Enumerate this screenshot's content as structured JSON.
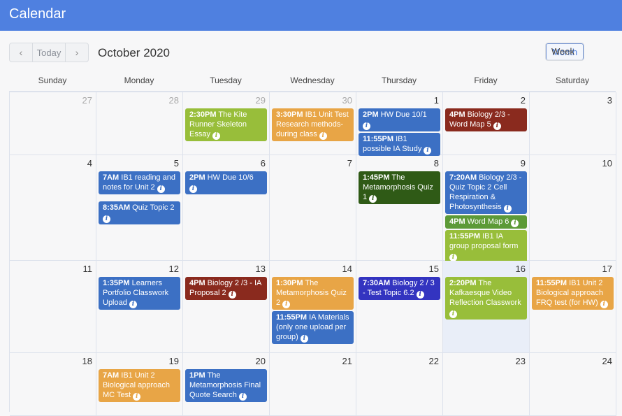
{
  "app": {
    "title": "Calendar"
  },
  "toolbar": {
    "prev_icon": "‹",
    "today_label": "Today",
    "next_icon": "›",
    "month_label": "October 2020",
    "views": [
      "Month",
      "Week"
    ],
    "active_view": "Month"
  },
  "days_of_week": [
    "Sunday",
    "Monday",
    "Tuesday",
    "Wednesday",
    "Thursday",
    "Friday",
    "Saturday"
  ],
  "colors": {
    "header": "#4f80e0",
    "blue": "#3c70c4",
    "green": "#98be3a",
    "orange": "#e8a546",
    "red": "#8a2a1e",
    "dkgreen": "#2f5a16",
    "medgreen": "#5c9a37",
    "indigo": "#3334c0"
  },
  "weeks": [
    [
      {
        "num": "27",
        "other": true,
        "events": []
      },
      {
        "num": "28",
        "other": true,
        "events": []
      },
      {
        "num": "29",
        "other": true,
        "events": [
          {
            "time": "2:30PM",
            "title": "The Kite Runner Skeleton Essay",
            "color": "green"
          }
        ]
      },
      {
        "num": "30",
        "other": true,
        "events": [
          {
            "time": "3:30PM",
            "title": "IB1 Unit Test Research methods- during class",
            "color": "orange"
          }
        ]
      },
      {
        "num": "1",
        "events": [
          {
            "time": "2PM",
            "title": "HW Due 10/1",
            "color": "blue"
          },
          {
            "time": "11:55PM",
            "title": "IB1 possible IA Study",
            "color": "blue"
          }
        ]
      },
      {
        "num": "2",
        "events": [
          {
            "time": "4PM",
            "title": "Biology 2/3 - Word Map 5",
            "color": "red"
          }
        ]
      },
      {
        "num": "3",
        "events": []
      }
    ],
    [
      {
        "num": "4",
        "events": []
      },
      {
        "num": "5",
        "events": [
          {
            "time": "7AM",
            "title": "IB1 reading and notes for Unit 2",
            "color": "blue"
          },
          {
            "time": "8:35AM",
            "title": "Quiz Topic 2",
            "color": "blue",
            "gap": true
          }
        ]
      },
      {
        "num": "6",
        "events": [
          {
            "time": "2PM",
            "title": "HW Due 10/6",
            "color": "blue"
          }
        ]
      },
      {
        "num": "7",
        "events": []
      },
      {
        "num": "8",
        "events": [
          {
            "time": "1:45PM",
            "title": "The Metamorphosis Quiz 1",
            "color": "dkgreen"
          }
        ]
      },
      {
        "num": "9",
        "events": [
          {
            "time": "7:20AM",
            "title": "Biology 2/3 - Quiz Topic 2 Cell Respiration & Photosynthesis",
            "color": "blue"
          },
          {
            "time": "4PM",
            "title": "Word Map 6",
            "color": "medgreen"
          },
          {
            "time": "11:55PM",
            "title": "IB1 IA group proposal form",
            "color": "green"
          }
        ]
      },
      {
        "num": "10",
        "events": []
      }
    ],
    [
      {
        "num": "11",
        "events": []
      },
      {
        "num": "12",
        "events": [
          {
            "time": "1:35PM",
            "title": "Learners Portfolio Classwork Upload",
            "color": "blue"
          }
        ]
      },
      {
        "num": "13",
        "events": [
          {
            "time": "4PM",
            "title": "Biology 2 /3 - IA Proposal 2",
            "color": "red"
          }
        ]
      },
      {
        "num": "14",
        "events": [
          {
            "time": "1:30PM",
            "title": "The Metamorphosis Quiz 2",
            "color": "orange"
          },
          {
            "time": "11:55PM",
            "title": "IA Materials (only one upload per group)",
            "color": "blue"
          }
        ]
      },
      {
        "num": "15",
        "events": [
          {
            "time": "7:30AM",
            "title": "Biology 2 / 3 - Test Topic 6.2",
            "color": "indigo"
          }
        ]
      },
      {
        "num": "16",
        "today": true,
        "events": [
          {
            "time": "2:20PM",
            "title": "The Kafkaesque Video Reflection Classwork",
            "color": "green"
          }
        ]
      },
      {
        "num": "17",
        "events": [
          {
            "time": "11:55PM",
            "title": "IB1 Unit 2 Biological approach FRQ test (for HW)",
            "color": "orange"
          }
        ]
      }
    ],
    [
      {
        "num": "18",
        "events": []
      },
      {
        "num": "19",
        "events": [
          {
            "time": "7AM",
            "title": "IB1 Unit 2 Biological approach MC Test",
            "color": "orange"
          }
        ]
      },
      {
        "num": "20",
        "events": [
          {
            "time": "1PM",
            "title": "The Metamorphosis Final Quote Search",
            "color": "blue"
          }
        ]
      },
      {
        "num": "21",
        "events": []
      },
      {
        "num": "22",
        "events": []
      },
      {
        "num": "23",
        "events": []
      },
      {
        "num": "24",
        "events": []
      }
    ]
  ]
}
